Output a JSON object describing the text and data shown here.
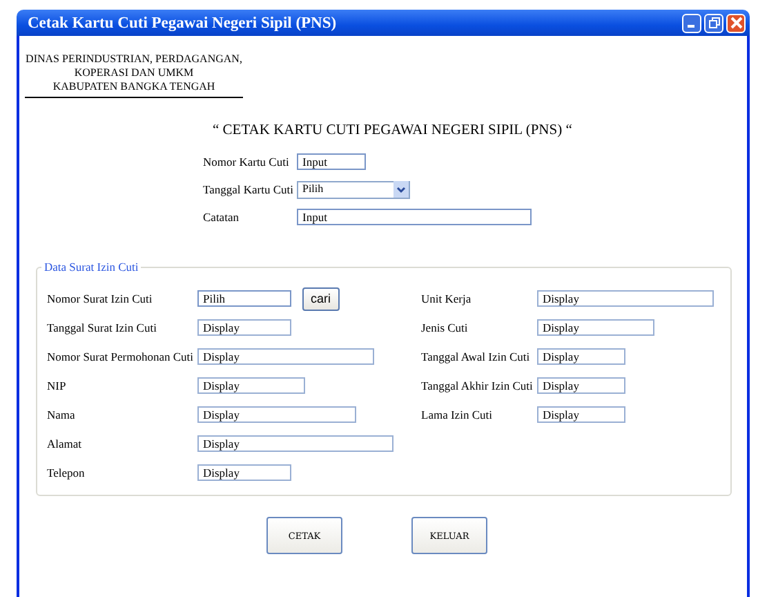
{
  "window": {
    "title": "Cetak Kartu Cuti Pegawai Negeri Sipil (PNS)"
  },
  "header": {
    "lines": [
      "DINAS PERINDUSTRIAN, PERDAGANGAN,",
      "KOPERASI DAN UMKM",
      "KABUPATEN BANGKA TENGAH"
    ]
  },
  "heading": "“ CETAK KARTU CUTI PEGAWAI NEGERI SIPIL (PNS) “",
  "card_form": [
    {
      "label": "Nomor Kartu Cuti",
      "kind": "input",
      "value": "Input"
    },
    {
      "label": "Tanggal Kartu Cuti",
      "kind": "select",
      "value": "Pilih"
    },
    {
      "label": "Catatan",
      "kind": "input",
      "value": "Input"
    }
  ],
  "group": {
    "legend": "Data Surat Izin Cuti",
    "left": [
      {
        "label": "Nomor Surat Izin Cuti",
        "kind": "input",
        "value": "Pilih",
        "button": "cari"
      },
      {
        "label": "Tanggal Surat Izin Cuti",
        "kind": "display",
        "value": "Display"
      },
      {
        "label": "Nomor Surat Permohonan Cuti",
        "kind": "display",
        "value": "Display"
      },
      {
        "label": "NIP",
        "kind": "display",
        "value": "Display"
      },
      {
        "label": "Nama",
        "kind": "display",
        "value": "Display"
      },
      {
        "label": "Alamat",
        "kind": "display",
        "value": "Display"
      },
      {
        "label": "Telepon",
        "kind": "display",
        "value": "Display"
      }
    ],
    "right": [
      {
        "label": "Unit Kerja",
        "kind": "display",
        "value": "Display"
      },
      {
        "label": "Jenis Cuti",
        "kind": "display",
        "value": "Display"
      },
      {
        "label": "Tanggal Awal Izin Cuti",
        "kind": "display",
        "value": "Display"
      },
      {
        "label": "Tanggal Akhir Izin Cuti",
        "kind": "display",
        "value": "Display"
      },
      {
        "label": "Lama Izin Cuti",
        "kind": "display",
        "value": "Display"
      }
    ]
  },
  "buttons": [
    "CETAK",
    "KELUAR"
  ]
}
